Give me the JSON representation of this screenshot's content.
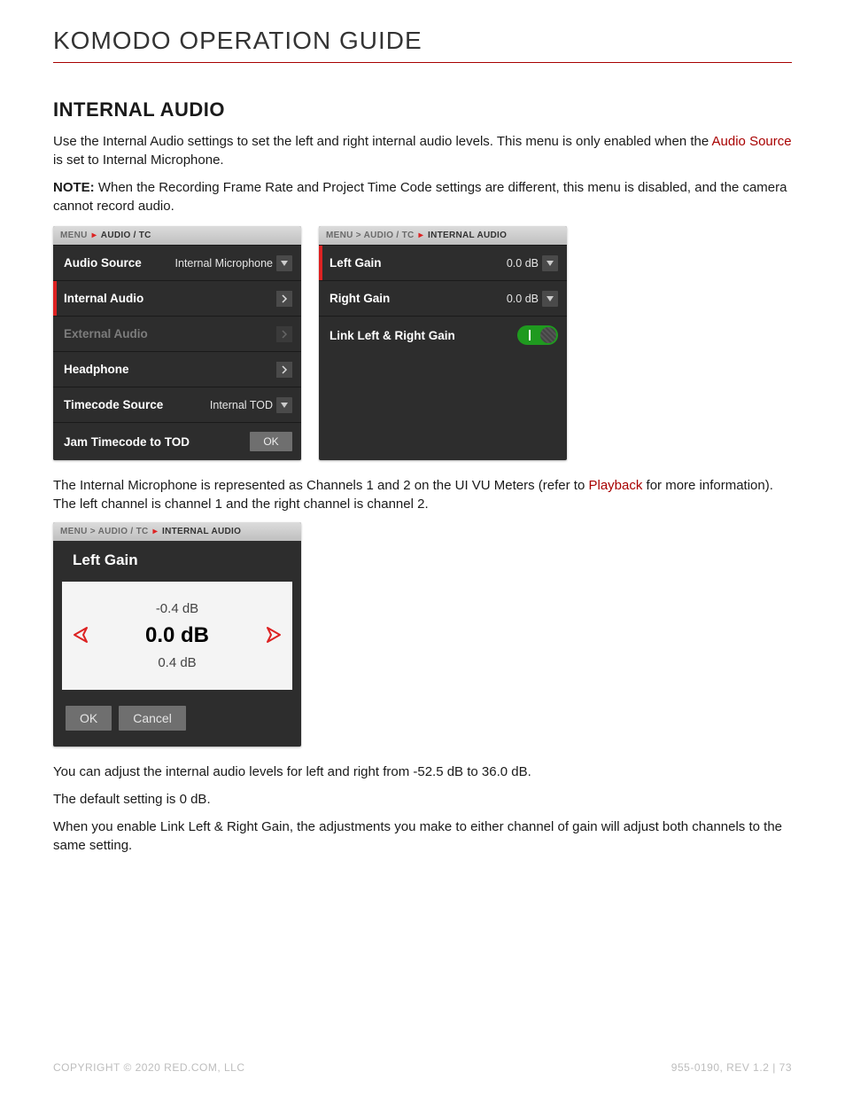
{
  "header": {
    "title": "KOMODO OPERATION GUIDE"
  },
  "section": {
    "heading": "INTERNAL AUDIO",
    "intro_a": "Use the Internal Audio settings to set the left and right internal audio levels. This menu is only enabled when the ",
    "intro_link": "Audio Source",
    "intro_b": " is set to Internal Microphone.",
    "note_label": "NOTE:",
    "note_text": " When the Recording Frame Rate and Project Time Code settings are different, this menu is disabled, and the camera cannot record audio."
  },
  "panel1": {
    "crumb_root": "MENU",
    "crumb_leaf": "AUDIO / TC",
    "rows": {
      "audio_source": {
        "label": "Audio Source",
        "value": "Internal Microphone"
      },
      "internal_audio": {
        "label": "Internal Audio"
      },
      "external_audio": {
        "label": "External Audio"
      },
      "headphone": {
        "label": "Headphone"
      },
      "timecode_source": {
        "label": "Timecode Source",
        "value": "Internal TOD"
      },
      "jam": {
        "label": "Jam Timecode to TOD",
        "btn": "OK"
      }
    }
  },
  "panel2": {
    "crumb_root": "MENU",
    "crumb_mid": "AUDIO / TC",
    "crumb_leaf": "INTERNAL AUDIO",
    "rows": {
      "left_gain": {
        "label": "Left Gain",
        "value": "0.0 dB"
      },
      "right_gain": {
        "label": "Right Gain",
        "value": "0.0 dB"
      },
      "link": {
        "label": "Link Left & Right Gain"
      }
    }
  },
  "mid_text": {
    "a": "The Internal Microphone is represented as Channels 1 and 2 on the UI VU Meters (refer to ",
    "link": "Playback",
    "b": " for more information). The left channel is channel 1 and the right channel is channel 2."
  },
  "gain_dialog": {
    "crumb_root": "MENU",
    "crumb_mid": "AUDIO / TC",
    "crumb_leaf": "INTERNAL AUDIO",
    "title": "Left Gain",
    "prev": "-0.4 dB",
    "current": "0.0 dB",
    "next": "0.4 dB",
    "ok": "OK",
    "cancel": "Cancel"
  },
  "tail": {
    "p1": "You can adjust the internal audio levels for left and right from -52.5 dB to 36.0 dB.",
    "p2": "The default setting is 0 dB.",
    "p3": "When you enable Link Left & Right Gain, the adjustments you make to either channel of gain will adjust both channels to the same setting."
  },
  "footer": {
    "left": "COPYRIGHT © 2020 RED.COM, LLC",
    "right": "955-0190, REV 1.2  |  73"
  }
}
